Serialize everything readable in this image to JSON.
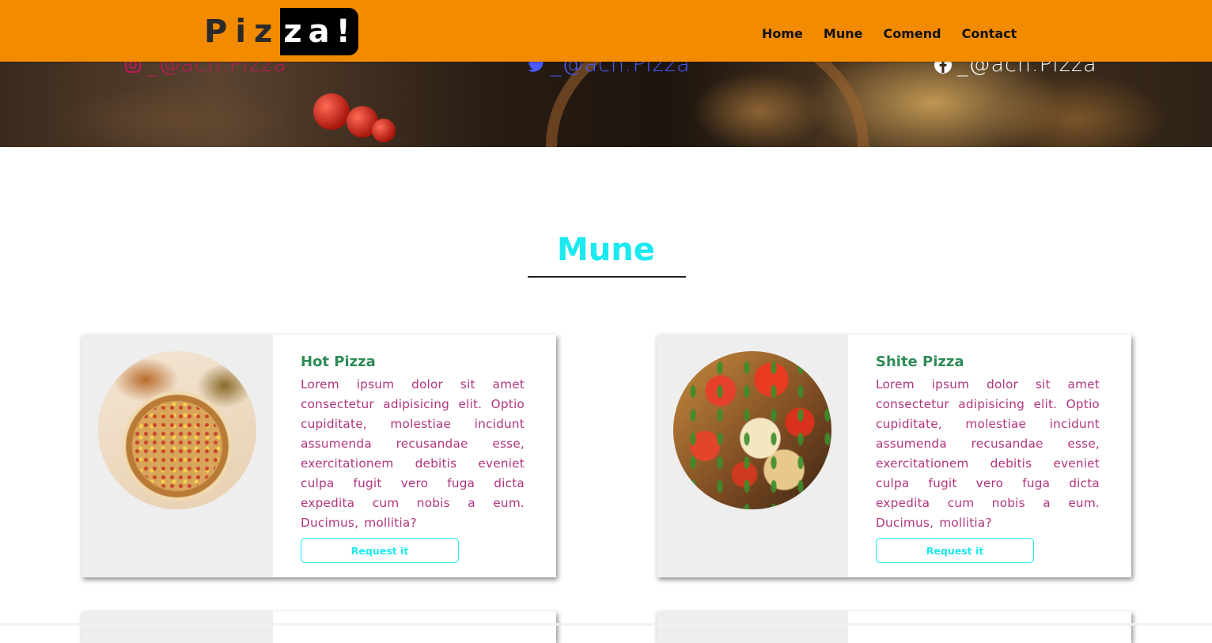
{
  "brand": {
    "logo_part1": "Piz",
    "logo_part2": "za!",
    "colors": {
      "nav_bg": "#f38b00",
      "title": "#1de9f0",
      "card_title": "#2e8b57",
      "card_text": "#b0357f"
    }
  },
  "nav": {
    "items": [
      {
        "label": "Home"
      },
      {
        "label": "Mune"
      },
      {
        "label": "Comend"
      },
      {
        "label": "Contact"
      }
    ]
  },
  "hero": {
    "socials": [
      {
        "icon": "instagram-icon",
        "handle": "_@ach.Pizza"
      },
      {
        "icon": "twitter-icon",
        "handle": "_@ach.Pizza"
      },
      {
        "icon": "facebook-icon",
        "handle": "_@ach.Pizza"
      }
    ]
  },
  "menu": {
    "title": "Mune",
    "items": [
      {
        "name": "Hot Pizza",
        "description": "Lorem ipsum dolor sit amet consectetur adipisicing elit. Optio cupiditate, molestiae incidunt assumenda recusandae esse, exercitationem debitis eveniet culpa fugit vero fuga dicta expedita cum nobis a eum. Ducimus, mollitia?",
        "button_label": "Request it"
      },
      {
        "name": "Shite Pizza",
        "description": "Lorem ipsum dolor sit amet consectetur adipisicing elit. Optio cupiditate, molestiae incidunt assumenda recusandae esse, exercitationem debitis eveniet culpa fugit vero fuga dicta expedita cum nobis a eum. Ducimus, mollitia?",
        "button_label": "Request it"
      }
    ]
  }
}
